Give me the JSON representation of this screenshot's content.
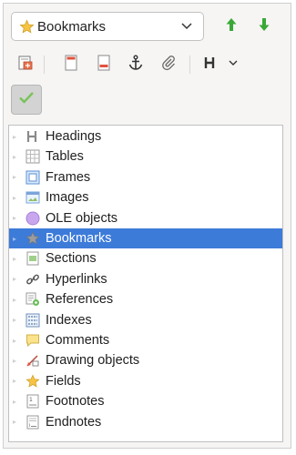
{
  "navigator": {
    "category_select": {
      "value": "Bookmarks",
      "icon": "star-icon"
    },
    "nav_buttons": [
      {
        "name": "previous-button",
        "icon": "arrow-up-icon"
      },
      {
        "name": "next-button",
        "icon": "arrow-down-icon"
      }
    ],
    "toolbar": [
      {
        "name": "toggle-navigator-icon"
      },
      {
        "name": "set-reminder-icon"
      },
      {
        "name": "header-icon"
      },
      {
        "name": "footer-icon"
      },
      {
        "name": "anchor-icon"
      },
      {
        "name": "paperclip-icon"
      },
      {
        "name": "heading-levels-icon"
      }
    ],
    "update_button": {
      "icon": "checkmark-icon"
    },
    "tree_items": [
      {
        "label": "Headings",
        "icon": "heading-icon"
      },
      {
        "label": "Tables",
        "icon": "table-icon"
      },
      {
        "label": "Frames",
        "icon": "frame-icon"
      },
      {
        "label": "Images",
        "icon": "image-icon"
      },
      {
        "label": "OLE objects",
        "icon": "ole-object-icon"
      },
      {
        "label": "Bookmarks",
        "icon": "bookmark-star-icon",
        "selected": true
      },
      {
        "label": "Sections",
        "icon": "section-icon"
      },
      {
        "label": "Hyperlinks",
        "icon": "hyperlink-icon"
      },
      {
        "label": "References",
        "icon": "reference-icon"
      },
      {
        "label": "Indexes",
        "icon": "index-icon"
      },
      {
        "label": "Comments",
        "icon": "comment-icon"
      },
      {
        "label": "Drawing objects",
        "icon": "drawing-object-icon"
      },
      {
        "label": "Fields",
        "icon": "field-star-icon"
      },
      {
        "label": "Footnotes",
        "icon": "footnote-icon"
      },
      {
        "label": "Endnotes",
        "icon": "endnote-icon"
      }
    ],
    "colors": {
      "selection": "#3d7bd9",
      "arrow_green": "#3aa836",
      "accent_red": "#e0533e"
    }
  }
}
